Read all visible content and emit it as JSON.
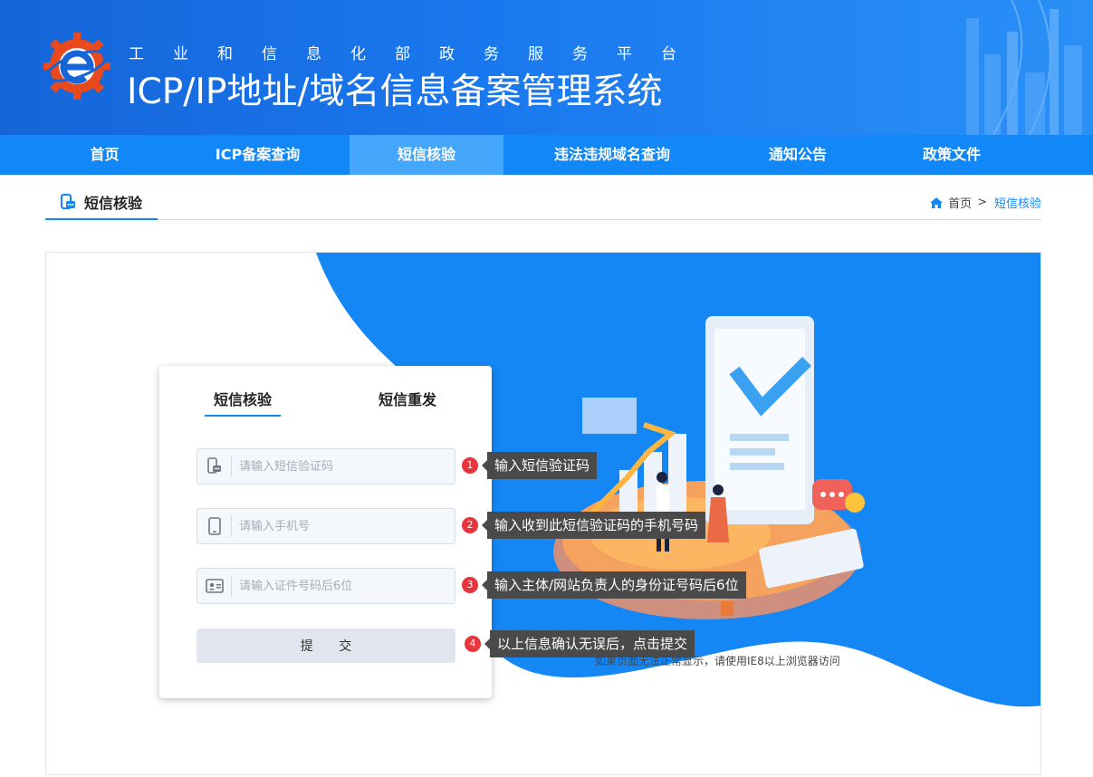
{
  "header": {
    "subtitle": "工业和信息化部政务服务平台",
    "title": "ICP/IP地址/域名信息备案管理系统"
  },
  "nav": [
    {
      "label": "首页",
      "active": false
    },
    {
      "label": "ICP备案查询",
      "active": false
    },
    {
      "label": "短信核验",
      "active": true
    },
    {
      "label": "违法违规域名查询",
      "active": false
    },
    {
      "label": "通知公告",
      "active": false
    },
    {
      "label": "政策文件",
      "active": false
    }
  ],
  "breadcrumb": {
    "section_title": "短信核验",
    "home": "首页",
    "separator": ">",
    "current": "短信核验"
  },
  "form": {
    "tabs": {
      "sms_verify": "短信核验",
      "sms_resend": "短信重发"
    },
    "code_placeholder": "请输入短信验证码",
    "phone_placeholder": "请输入手机号",
    "id_placeholder": "请输入证件号码后6位",
    "submit_label": "提 交"
  },
  "tips": [
    {
      "num": "1",
      "text": "输入短信验证码"
    },
    {
      "num": "2",
      "text": "输入收到此短信验证码的手机号码"
    },
    {
      "num": "3",
      "text": "输入主体/网站负责人的身份证号码后6位"
    },
    {
      "num": "4",
      "text": "以上信息确认无误后，点击提交"
    }
  ],
  "notice": "如果页面无法正常显示，请使用IE8以上浏览器访问",
  "colors": {
    "primary": "#1287f7",
    "nav_active": "#45a7fb",
    "badge": "#e8353b",
    "tip_bg": "#4a4a4a"
  }
}
